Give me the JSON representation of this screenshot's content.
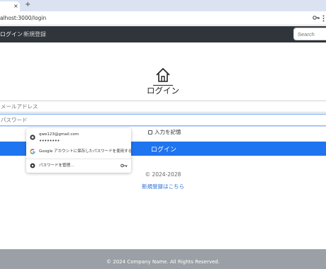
{
  "browser": {
    "tab_close": "×",
    "new_tab": "+",
    "url": "alhost:3000/login"
  },
  "navbar": {
    "login_link": "ログイン",
    "register_link": "新規登録",
    "search_placeholder": "Search"
  },
  "main": {
    "icon": "home-icon",
    "title": "ログイン",
    "email_placeholder": "メールアドレス",
    "password_placeholder": "パスワード",
    "remember_label": "入力を記憶",
    "login_button": "ログイン",
    "copyright": "© 2024-2028",
    "register_link": "新規登録はこちら"
  },
  "autofill_popup": {
    "saved_email": "qwe123@gmail.com",
    "saved_password_mask": "••••••••",
    "google_option": "Google アカウントに保存したパスワードを使用する",
    "manage_option": "パスワードを管理..."
  },
  "footer": {
    "text": "© 2024 Company Name. All Rights Reserved."
  },
  "colors": {
    "navbar_bg": "#2f353a",
    "primary": "#1f74ef",
    "footer_bg": "#9aa0a6",
    "link": "#2a6fd6"
  }
}
